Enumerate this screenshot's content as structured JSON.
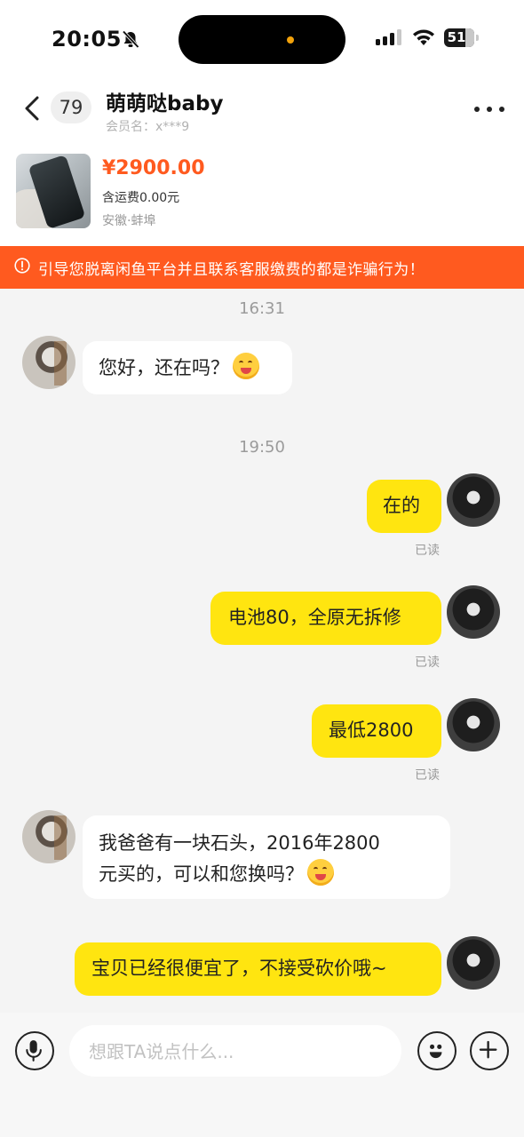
{
  "status_bar": {
    "time": "20:05",
    "battery": "51"
  },
  "header": {
    "unread_count": "79",
    "contact_name": "萌萌哒baby",
    "member_label": "会员名：x***9"
  },
  "product": {
    "price": "¥2900.00",
    "shipping": "含运费0.00元",
    "location": "安徽·蚌埠"
  },
  "warning_text": "引导您脱离闲鱼平台并且联系客服缴费的都是诈骗行为！",
  "chat": {
    "timestamps": [
      "16:31",
      "19:50"
    ],
    "messages": [
      {
        "side": "in",
        "text": "您好，还在吗？"
      },
      {
        "side": "out",
        "text": "在的",
        "status": "已读"
      },
      {
        "side": "out",
        "text": "电池80，全原无拆修",
        "status": "已读"
      },
      {
        "side": "out",
        "text": "最低2800",
        "status": "已读"
      },
      {
        "side": "in",
        "text_line1": "我爸爸有一块石头，2016年2800",
        "text_line2": "元买的，可以和您换吗？"
      },
      {
        "side": "out",
        "text": "宝贝已经很便宜了，不接受砍价哦~"
      }
    ]
  },
  "input": {
    "placeholder": "想跟TA说点什么..."
  },
  "colors": {
    "accent_yellow": "#ffe510",
    "warning_orange": "#ff5a1f",
    "price_orange": "#ff5a1f"
  },
  "icons": [
    "back-icon",
    "more-icon",
    "warning-icon",
    "voice-icon",
    "emoji-icon",
    "plus-icon"
  ]
}
